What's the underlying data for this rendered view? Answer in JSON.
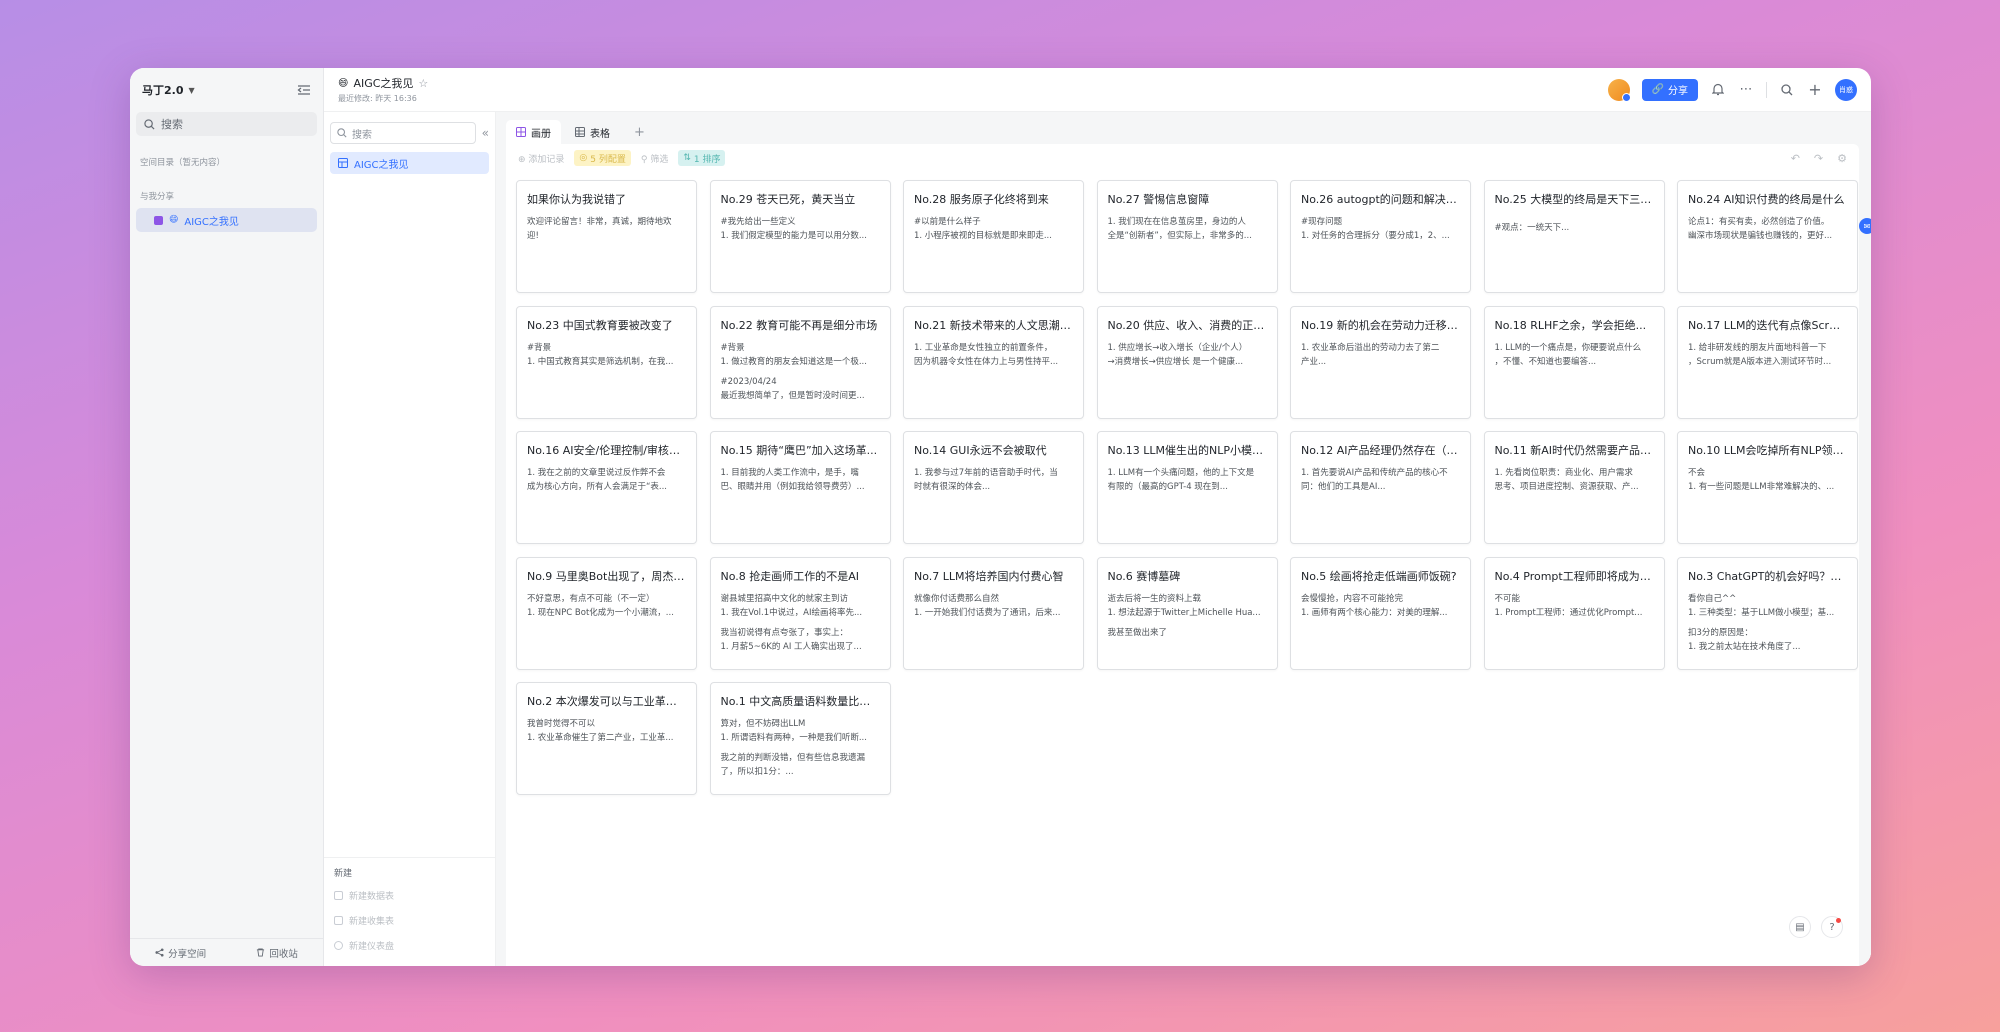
{
  "sidebar": {
    "space_name": "马丁2.0",
    "search_placeholder": "搜索",
    "section_catalog": "空间目录（暂无内容）",
    "section_shared": "与我分享",
    "shared_item": "AIGC之我见",
    "footer_share": "分享空间",
    "footer_trash": "回收站"
  },
  "header": {
    "title": "AIGC之我见",
    "subtitle": "最近修改: 昨天 16:36",
    "share_label": "分享",
    "user_avatar_text": "肖惑"
  },
  "tree": {
    "search_placeholder": "搜索",
    "item": "AIGC之我见",
    "new_label": "新建",
    "new_items": [
      "新建数据表",
      "新建收集表",
      "新建仪表盘"
    ]
  },
  "tabs": [
    {
      "label": "画册",
      "active": true
    },
    {
      "label": "表格",
      "active": false
    }
  ],
  "toolbar": {
    "add_record": "添加记录",
    "filter_chip": "5 列配置",
    "filter": "筛选",
    "sort_chip": "1 排序"
  },
  "cards": [
    {
      "title": "如果你认为我说错了",
      "lines": [
        "欢迎评论留言！非常，真诚，期待地欢",
        "迎!"
      ]
    },
    {
      "title": "No.29 苍天已死，黄天当立",
      "lines": [
        "#我先给出一些定义",
        "1. 我们假定模型的能力是可以用分数..."
      ]
    },
    {
      "title": "No.28 服务原子化终将到来",
      "lines": [
        "#以前是什么样子",
        "1. 小程序被视的目标就是即来即走..."
      ]
    },
    {
      "title": "No.27 警惕信息窗障",
      "lines": [
        "1. 我们现在在信息茧房里，身边的人",
        "全是“创新者”，但实际上，非常多的..."
      ]
    },
    {
      "title": "No.26 autogpt的问题和解决方案",
      "lines": [
        "#现存问题",
        "1. 对任务的合理拆分（要分成1，2、..."
      ]
    },
    {
      "title": "No.25 大模型的终局是天下三分...",
      "lines": [
        "",
        "#观点：一统天下..."
      ]
    },
    {
      "title": "No.24 AI知识付费的终局是什么",
      "lines": [
        "论点1：有买有卖，必然创造了价值。",
        "幽深市场现状是骗钱也赚钱的，更好..."
      ]
    },
    {
      "title": "No.23 中国式教育要被改变了",
      "lines": [
        "#背景",
        "1. 中国式教育其实是筛选机制，在我..."
      ]
    },
    {
      "title": "No.22 教育可能不再是细分市场",
      "lines": [
        "#背景",
        "1. 做过教育的朋友会知道这是一个极...",
        "",
        "#2023/04/24",
        "最近我想简单了，但是暂时没时间更..."
      ]
    },
    {
      "title": "No.21 新技术带来的人文思潮变...",
      "lines": [
        "1. 工业革命是女性独立的前置条件，",
        "因为机器令女性在体力上与男性持平..."
      ]
    },
    {
      "title": "No.20 供应、收入、消费的正向...",
      "lines": [
        "1. 供应增长→收入增长（企业/个人）",
        "→消费增长→供应增长 是一个健康..."
      ]
    },
    {
      "title": "No.19 新的机会在劳动力迁移中...",
      "lines": [
        "1. 农业革命后溢出的劳动力去了第二",
        "产业..."
      ]
    },
    {
      "title": "No.18 RLHF之余，学会拒绝...",
      "lines": [
        "1. LLM的一个痛点是，你硬要说点什么",
        "，不懂、不知道也要编答..."
      ]
    },
    {
      "title": "No.17 LLM的迭代有点像Scrum...",
      "lines": [
        "1. 给非研发线的朋友片面地科普一下",
        "，Scrum就是A版本进入测试环节时..."
      ]
    },
    {
      "title": "No.16 AI安全/伦理控制/审核不...",
      "lines": [
        "1. 我在之前的文章里说过反作弊不会",
        "成为核心方向，所有人会满足于“表..."
      ]
    },
    {
      "title": "No.15 期待“鹰巴”加入这场革...",
      "lines": [
        "1. 目前我的人类工作流中，是手，嘴",
        "巴、眼睛并用（例如我给领导费劳）..."
      ]
    },
    {
      "title": "No.14 GUI永远不会被取代",
      "lines": [
        "1. 我参与过7年前的语音助手时代，当",
        "时就有很深的体会..."
      ]
    },
    {
      "title": "No.13 LLM催生出的NLP小模型...",
      "lines": [
        "1. LLM有一个头痛问题，他的上下文是",
        "有限的（最高的GPT-4 现在到..."
      ]
    },
    {
      "title": "No.12 AI产品经理仍然存在（哪...",
      "lines": [
        "1. 首先要说AI产品和传统产品的核心不",
        "同：他们的工具是AI..."
      ]
    },
    {
      "title": "No.11 新AI时代仍然需要产品经理",
      "lines": [
        "1. 先看岗位职责：商业化、用户需求",
        "思考、项目进度控制、资源获取、产..."
      ]
    },
    {
      "title": "No.10 LLM会吃掉所有NLP领域...",
      "lines": [
        "不会",
        "1. 有一些问题是LLM非常难解决的、..."
      ]
    },
    {
      "title": "No.9 马里奥Bot出现了，周杰伦...",
      "lines": [
        "不好意思，有点不可能（不一定）",
        "1. 现在NPC Bot化成为一个小潮流，..."
      ]
    },
    {
      "title": "No.8 抢走画师工作的不是AI",
      "lines": [
        "谢县城里招高中文化的就家主到访",
        "1. 我在Vol.1中说过，AI绘画将率先...",
        "",
        "我当初说得有点夸张了，事实上：",
        "1. 月薪5~6K的 AI 工人确实出现了..."
      ]
    },
    {
      "title": "No.7 LLM将培养国内付费心智",
      "lines": [
        "就像你付话费那么自然",
        "1. 一开始我们付话费为了通讯，后来..."
      ]
    },
    {
      "title": "No.6 赛博墓碑",
      "lines": [
        "逝去后将一生的资料上载",
        "1. 想法起源于Twitter上Michelle Hua...",
        "",
        "我甚至做出来了"
      ]
    },
    {
      "title": "No.5 绘画将抢走低端画师饭碗?",
      "lines": [
        "会慢慢抢，内容不可能抢完",
        "1. 画师有两个核心能力：对美的理解..."
      ]
    },
    {
      "title": "No.4 Prompt工程师即将成为一...",
      "lines": [
        "不可能",
        "1. Prompt工程师：通过优化Prompt..."
      ]
    },
    {
      "title": "No.3 ChatGPT的机会好吗？值...",
      "lines": [
        "看你自己^^",
        "1. 三种类型：基于LLM做小模型；基...",
        "",
        "扣3分的原因是：",
        "1. 我之前太站在技术角度了..."
      ]
    },
    {
      "title": "No.2 本次爆发可以与工业革命...",
      "lines": [
        "我曾时觉得不可以",
        "1. 农业革命催生了第二产业，工业革..."
      ]
    },
    {
      "title": "No.1 中文高质量语料数量比英...",
      "lines": [
        "算对，但不妨碍出LLM",
        "1. 所谓语料有两种，一种是我们听断...",
        "",
        "我之前的判断没错，但有些信息我遗漏",
        "了，所以扣1分：..."
      ]
    }
  ]
}
